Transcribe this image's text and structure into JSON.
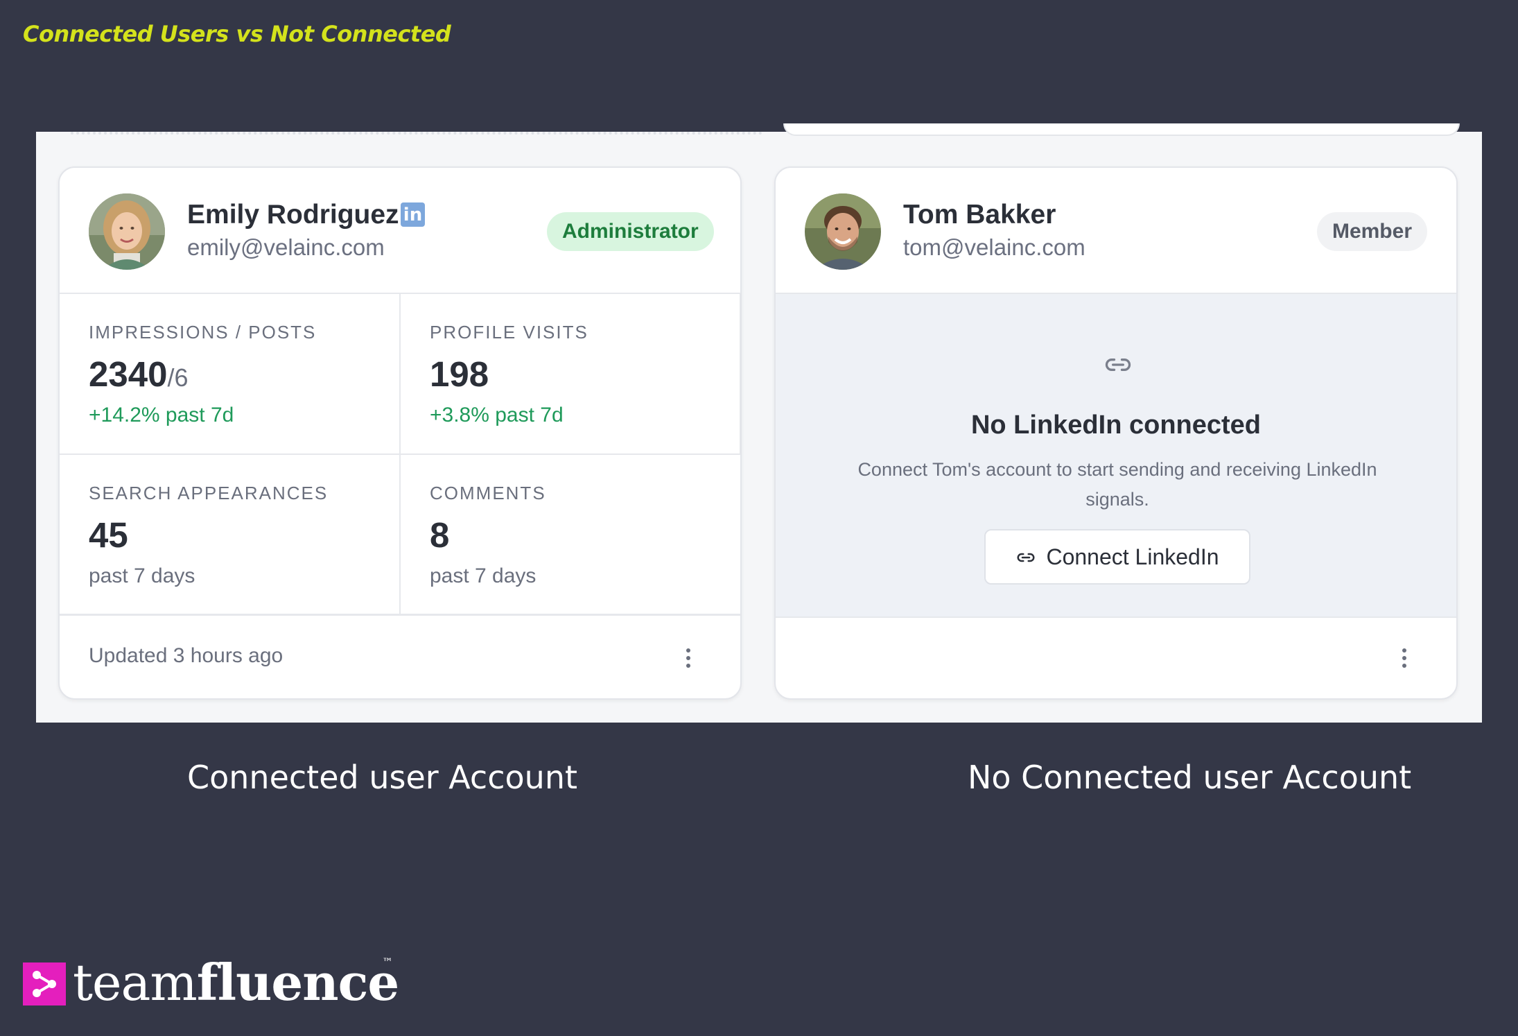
{
  "slide_title": "Connected Users vs Not Connected",
  "connected_card": {
    "name": "Emily Rodriguez",
    "email": "emily@velainc.com",
    "linkedin_icon": "in",
    "role": "Administrator",
    "stats": [
      {
        "label": "IMPRESSIONS / POSTS",
        "value": "2340",
        "suffix": "/6",
        "change": "+14.2% past 7d"
      },
      {
        "label": "PROFILE VISITS",
        "value": "198",
        "change": "+3.8% past 7d"
      },
      {
        "label": "SEARCH APPEARANCES",
        "value": "45",
        "note": "past 7 days"
      },
      {
        "label": "COMMENTS",
        "value": "8",
        "note": "past 7 days"
      }
    ],
    "footer": "Updated 3 hours ago"
  },
  "disconnected_card": {
    "name": "Tom Bakker",
    "email": "tom@velainc.com",
    "role": "Member",
    "empty_title": "No LinkedIn connected",
    "empty_description": "Connect Tom's account to start sending and receiving LinkedIn signals.",
    "connect_button": "Connect LinkedIn"
  },
  "captions": {
    "left": "Connected user Account",
    "right": "No Connected user Account"
  },
  "brand": {
    "light": "team",
    "bold": "fluence",
    "tm": "™"
  },
  "colors": {
    "background": "#343747",
    "title_accent": "#d4e21c",
    "admin_badge_bg": "#d8f5df",
    "admin_badge_text": "#1d7d3c",
    "positive_change": "#1f9a5a",
    "brand_magenta": "#e41fbd",
    "linkedin_icon": "#7da7dc"
  },
  "icons": {
    "linkedin": "linkedin-icon",
    "link": "link-icon",
    "kebab": "more-vertical-icon",
    "brand": "teamfluence-logo-icon"
  }
}
